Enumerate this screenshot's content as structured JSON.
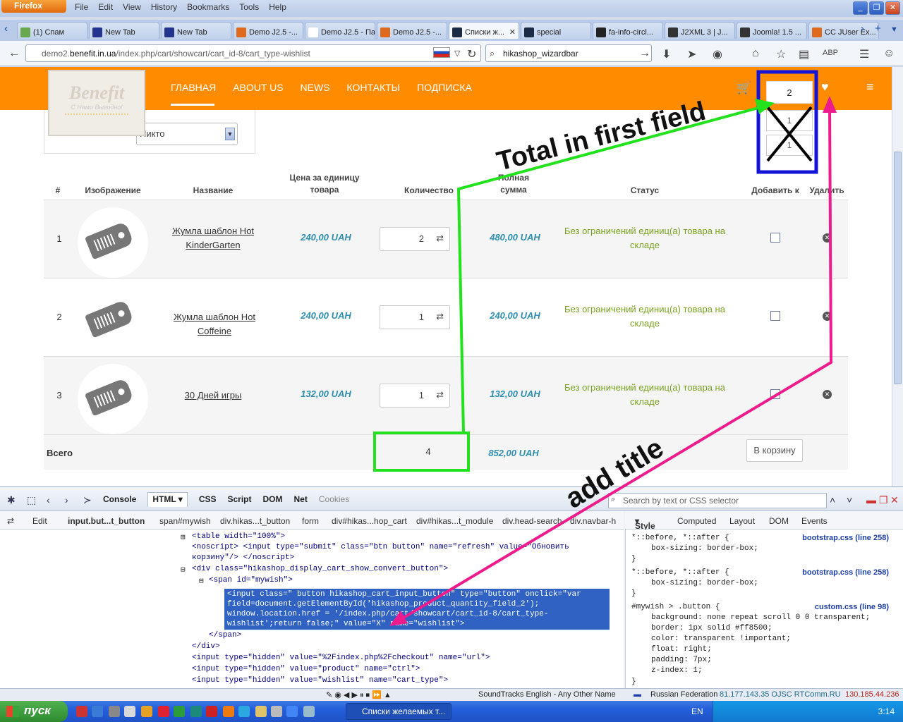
{
  "browser": {
    "app_button": "Firefox",
    "menu": [
      "File",
      "Edit",
      "View",
      "History",
      "Bookmarks",
      "Tools",
      "Help"
    ],
    "tabs": [
      {
        "label": "(1) Спам",
        "color": "#6aa84f"
      },
      {
        "label": "New Tab",
        "color": "#23348f"
      },
      {
        "label": "New Tab",
        "color": "#23348f"
      },
      {
        "label": "Demo J2.5 -...",
        "color": "#e06a1b"
      },
      {
        "label": "Demo J2.5 - Па...",
        "color": "#ffffff"
      },
      {
        "label": "Demo J2.5 -...",
        "color": "#e06a1b"
      },
      {
        "label": "Списки ж...",
        "color": "#1c2b45",
        "active": true
      },
      {
        "label": "special",
        "color": "#1c2b45"
      },
      {
        "label": "fa-info-circl...",
        "color": "#222222"
      },
      {
        "label": "J2XML 3 | J...",
        "color": "#333333"
      },
      {
        "label": "Joomla! 1.5 ...",
        "color": "#333333"
      },
      {
        "label": "CC JUser Ex...",
        "color": "#e06a1b"
      }
    ],
    "url_prefix": "demo2.",
    "url_domain": "benefit.in.ua",
    "url_path": "/index.php/cart/showcart/cart_id-8/cart_type-wishlist",
    "search_value": "hikashop_wizardbar"
  },
  "site": {
    "logo_text": "Benefit",
    "logo_tagline": "С Нами Выгодно!",
    "nav": [
      "ГЛАВНАЯ",
      "ABOUT US",
      "NEWS",
      "КОНТАКТЫ",
      "ПОДПИСКА"
    ],
    "cart_count": "2",
    "wishlist_field_1": "1",
    "wishlist_field_2": "1",
    "user_select_value": "Никто",
    "accent_color": "#ff8c00"
  },
  "cart": {
    "headers": {
      "num": "#",
      "image": "Изображение",
      "name": "Название",
      "unit_price": "Цена за единицу товара",
      "quantity": "Количество",
      "total": "Полная сумма",
      "status": "Статус",
      "add_to": "Добавить к",
      "delete": "Удалить"
    },
    "rows": [
      {
        "num": "1",
        "name": "Жумла шаблон Hot KinderGarten",
        "price": "240,00 UAH",
        "qty": "2",
        "total": "480,00 UAH",
        "status": "Без ограничений единиц(а) товара на складе"
      },
      {
        "num": "2",
        "name": "Жумла шаблон Hot Coffeine",
        "price": "240,00 UAH",
        "qty": "1",
        "total": "240,00 UAH",
        "status": "Без ограничений единиц(а) товара на складе"
      },
      {
        "num": "3",
        "name": "30 Дней игры",
        "price": "132,00 UAH",
        "qty": "1",
        "total": "132,00 UAH",
        "status": "Без ограничений единиц(а) товара на складе"
      }
    ],
    "footer": {
      "label": "Всего",
      "qty": "4",
      "total": "852,00 UAH",
      "button": "В корзину"
    }
  },
  "firebug": {
    "tabs": [
      "Console",
      "HTML",
      "CSS",
      "Script",
      "DOM",
      "Net",
      "Cookies"
    ],
    "search_placeholder": "Search by text or CSS selector",
    "edit_label": "Edit",
    "crumbs": [
      "input.but...t_button",
      "span#mywish",
      "div.hikas...t_button",
      "form",
      "div#hikas...hop_cart",
      "div#hikas...t_module",
      "div.head-search",
      "div.navbar-h"
    ],
    "side_tabs": [
      "Style",
      "Computed",
      "Layout",
      "DOM",
      "Events"
    ],
    "html_lines": [
      "<table width=\"100%\">",
      "<noscript> <input type=\"submit\" class=\"btn button\" name=\"refresh\" value=\"Обновить",
      "корзину\"/> </noscript>",
      "<div class=\"hikashop_display_cart_show_convert_button\">",
      "<span id=\"mywish\">",
      "<input class=\" button hikashop_cart_input_button\" type=\"button\" onclick=\"var",
      "field=document.getElementById('hikashop_product_quantity_field_2');",
      "window.location.href = '/index.php/cart/showcart/cart_id-8/cart_type-",
      "wishlist';return false;\" value=\"X\" name=\"wishlist\">",
      "</span>",
      "</div>",
      "<input type=\"hidden\" value=\"%2Findex.php%2Fcheckout\" name=\"url\">",
      "<input type=\"hidden\" value=\"product\" name=\"ctrl\">",
      "<input type=\"hidden\" value=\"wishlist\" name=\"cart_type\">"
    ],
    "style_rules": [
      {
        "selector": "*::before, *::after {",
        "source": "bootstrap.css (line 258)",
        "props": [
          "box-sizing: border-box;"
        ]
      },
      {
        "selector": "*::before, *::after {",
        "source": "bootstrap.css (line 258)",
        "props": [
          "box-sizing: border-box;"
        ]
      },
      {
        "selector": "#mywish > .button {",
        "source": "custom.css (line 98)",
        "props": [
          "background: none repeat scroll 0 0 transparent;",
          "border: 1px solid #ff8500;",
          "color: transparent !important;",
          "float: right;",
          "padding: 7px;",
          "z-index: 1;"
        ]
      }
    ]
  },
  "statusbar": {
    "soundtracks": "SoundTracks English - Any Other Name",
    "country": "Russian Federation",
    "ip_info": "81.177.143.35  OJSC RTComm.RU",
    "ip2": "130.185.44.236"
  },
  "taskbar": {
    "start": "пуск",
    "window": "Списки желаемых т...",
    "lang": "EN",
    "clock": "3:14"
  },
  "annotations": {
    "total_note": "Total in first field",
    "title_note": "add title"
  }
}
